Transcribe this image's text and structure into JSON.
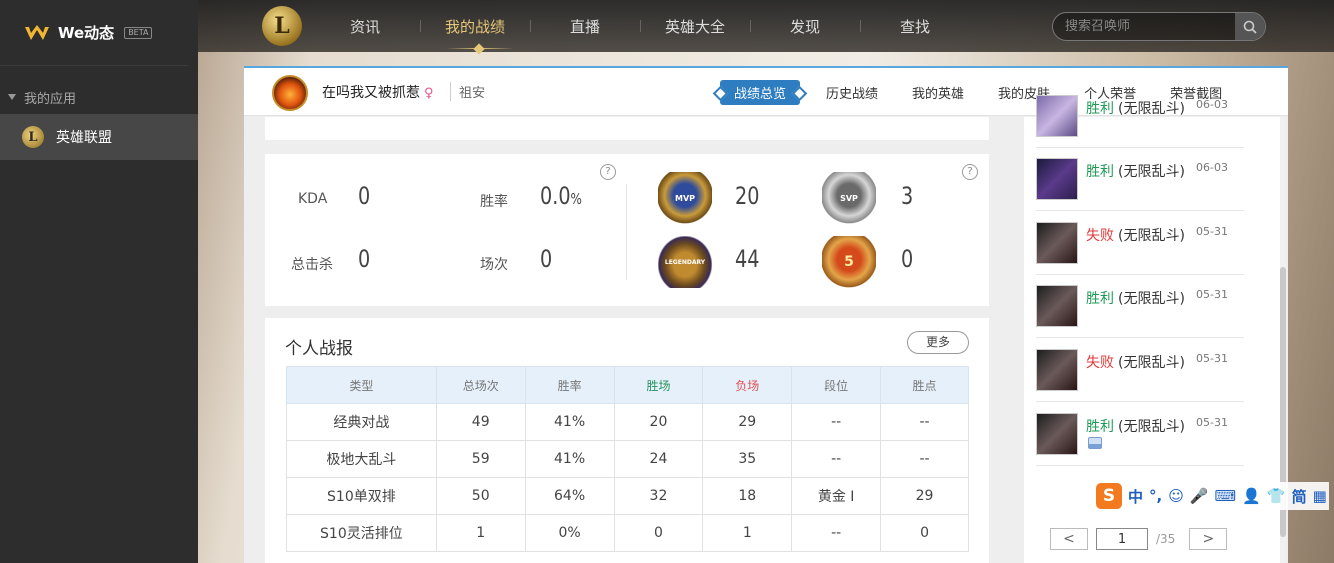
{
  "sidebar": {
    "brand": "We动态",
    "beta": "BETA",
    "group_label": "我的应用",
    "app_label": "英雄联盟",
    "app_icon_glyph": "L"
  },
  "topnav": {
    "logo_glyph": "L",
    "items": [
      "资讯",
      "我的战绩",
      "直播",
      "英雄大全",
      "发现",
      "查找"
    ],
    "active_index": 1,
    "search_placeholder": "搜索召唤师"
  },
  "profile": {
    "name": "在吗我又被抓惹",
    "gender_symbol": "♀",
    "server": "祖安",
    "tabs": [
      "战绩总览",
      "历史战绩",
      "我的英雄",
      "我的皮肤",
      "个人荣誉",
      "荣誉截图"
    ],
    "active_tab": 0
  },
  "stats": {
    "kda_label": "KDA",
    "kda_value": "0",
    "winrate_label": "胜率",
    "winrate_value": "0.0",
    "winrate_unit": "%",
    "kills_label": "总击杀",
    "kills_value": "0",
    "games_label": "场次",
    "games_value": "0",
    "help_glyph": "?",
    "badges": {
      "mvp_text": "MVP",
      "mvp_count": "20",
      "svp_text": "SVP",
      "svp_count": "3",
      "legendary_text": "LEGENDARY",
      "legendary_count": "44",
      "five_text": "5",
      "five_count": "0"
    }
  },
  "report": {
    "title": "个人战报",
    "more_label": "更多",
    "headers": [
      "类型",
      "总场次",
      "胜率",
      "胜场",
      "负场",
      "段位",
      "胜点"
    ],
    "rows": [
      [
        "经典对战",
        "49",
        "41%",
        "20",
        "29",
        "--",
        "--"
      ],
      [
        "极地大乱斗",
        "59",
        "41%",
        "24",
        "35",
        "--",
        "--"
      ],
      [
        "S10单双排",
        "50",
        "64%",
        "32",
        "18",
        "黄金 Ⅰ",
        "29"
      ],
      [
        "S10灵活排位",
        "1",
        "0%",
        "0",
        "1",
        "--",
        "0"
      ]
    ]
  },
  "matches": [
    {
      "result": "胜利",
      "mode": "(无限乱斗)",
      "date": "06-03",
      "outcome": "win"
    },
    {
      "result": "胜利",
      "mode": "(无限乱斗)",
      "date": "06-03",
      "outcome": "win"
    },
    {
      "result": "失败",
      "mode": "(无限乱斗)",
      "date": "05-31",
      "outcome": "lose"
    },
    {
      "result": "胜利",
      "mode": "(无限乱斗)",
      "date": "05-31",
      "outcome": "win"
    },
    {
      "result": "失败",
      "mode": "(无限乱斗)",
      "date": "05-31",
      "outcome": "lose"
    },
    {
      "result": "胜利",
      "mode": "(无限乱斗)",
      "date": "05-31",
      "outcome": "win"
    }
  ],
  "pager": {
    "prev": "<",
    "current": "1",
    "total": "/35",
    "next": ">"
  },
  "ime": {
    "logo": "S",
    "items": [
      "中",
      "°,",
      "☺",
      "🎤",
      "⌨",
      "👤",
      "👕",
      "简",
      "▦"
    ]
  },
  "colors": {
    "accent_blue": "#2e7dc1",
    "nav_active": "#e5c779",
    "win_green": "#1f9a57",
    "lose_red": "#e03a3a"
  }
}
